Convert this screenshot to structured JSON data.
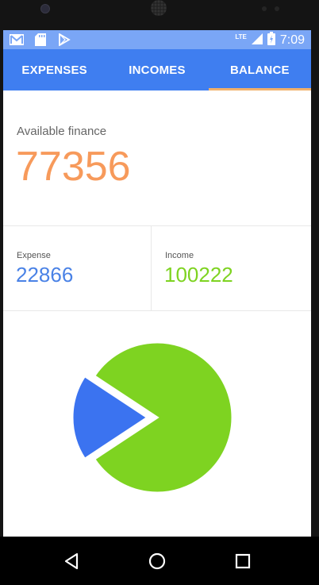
{
  "status_bar": {
    "time": "7:09",
    "network": "LTE",
    "icons": [
      "gmail-icon",
      "sd-card-icon",
      "play-store-icon",
      "signal-icon",
      "battery-icon"
    ]
  },
  "tabs": [
    {
      "label": "EXPENSES",
      "active": false
    },
    {
      "label": "INCOMES",
      "active": false
    },
    {
      "label": "BALANCE",
      "active": true
    }
  ],
  "balance": {
    "available_label": "Available finance",
    "available_value": "77356",
    "expense_label": "Expense",
    "expense_value": "22866",
    "income_label": "Income",
    "income_value": "100222"
  },
  "colors": {
    "accent": "#3f7ef0",
    "tab_indicator": "#f1b06a",
    "available": "#f79a5b",
    "expense": "#4a82e6",
    "income": "#7ed321",
    "pie_expense": "#3b73f0",
    "pie_income": "#7ed321"
  },
  "chart_data": {
    "type": "pie",
    "categories": [
      "Expense",
      "Income"
    ],
    "values": [
      22866,
      100222
    ],
    "colors": [
      "#3b73f0",
      "#7ed321"
    ],
    "exploded": "Expense"
  },
  "nav": {
    "icons": [
      "back-icon",
      "home-icon",
      "recents-icon"
    ]
  }
}
